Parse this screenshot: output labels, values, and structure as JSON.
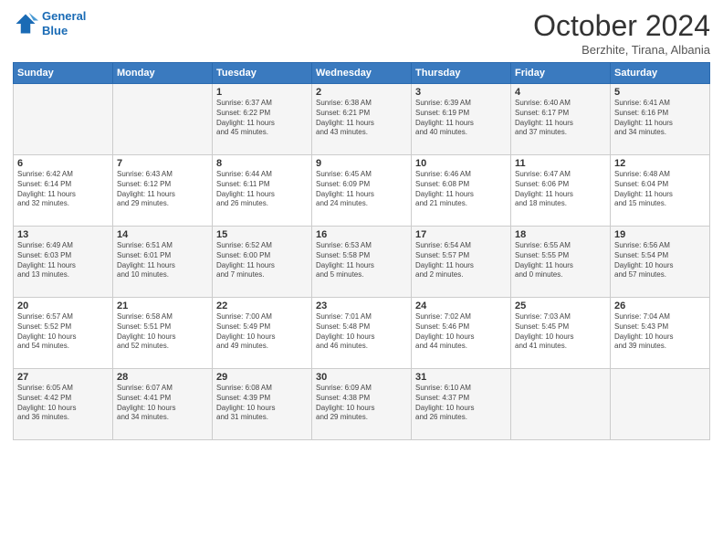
{
  "header": {
    "logo_line1": "General",
    "logo_line2": "Blue",
    "month": "October 2024",
    "location": "Berzhite, Tirana, Albania"
  },
  "weekdays": [
    "Sunday",
    "Monday",
    "Tuesday",
    "Wednesday",
    "Thursday",
    "Friday",
    "Saturday"
  ],
  "weeks": [
    [
      {
        "day": "",
        "info": ""
      },
      {
        "day": "",
        "info": ""
      },
      {
        "day": "1",
        "info": "Sunrise: 6:37 AM\nSunset: 6:22 PM\nDaylight: 11 hours\nand 45 minutes."
      },
      {
        "day": "2",
        "info": "Sunrise: 6:38 AM\nSunset: 6:21 PM\nDaylight: 11 hours\nand 43 minutes."
      },
      {
        "day": "3",
        "info": "Sunrise: 6:39 AM\nSunset: 6:19 PM\nDaylight: 11 hours\nand 40 minutes."
      },
      {
        "day": "4",
        "info": "Sunrise: 6:40 AM\nSunset: 6:17 PM\nDaylight: 11 hours\nand 37 minutes."
      },
      {
        "day": "5",
        "info": "Sunrise: 6:41 AM\nSunset: 6:16 PM\nDaylight: 11 hours\nand 34 minutes."
      }
    ],
    [
      {
        "day": "6",
        "info": "Sunrise: 6:42 AM\nSunset: 6:14 PM\nDaylight: 11 hours\nand 32 minutes."
      },
      {
        "day": "7",
        "info": "Sunrise: 6:43 AM\nSunset: 6:12 PM\nDaylight: 11 hours\nand 29 minutes."
      },
      {
        "day": "8",
        "info": "Sunrise: 6:44 AM\nSunset: 6:11 PM\nDaylight: 11 hours\nand 26 minutes."
      },
      {
        "day": "9",
        "info": "Sunrise: 6:45 AM\nSunset: 6:09 PM\nDaylight: 11 hours\nand 24 minutes."
      },
      {
        "day": "10",
        "info": "Sunrise: 6:46 AM\nSunset: 6:08 PM\nDaylight: 11 hours\nand 21 minutes."
      },
      {
        "day": "11",
        "info": "Sunrise: 6:47 AM\nSunset: 6:06 PM\nDaylight: 11 hours\nand 18 minutes."
      },
      {
        "day": "12",
        "info": "Sunrise: 6:48 AM\nSunset: 6:04 PM\nDaylight: 11 hours\nand 15 minutes."
      }
    ],
    [
      {
        "day": "13",
        "info": "Sunrise: 6:49 AM\nSunset: 6:03 PM\nDaylight: 11 hours\nand 13 minutes."
      },
      {
        "day": "14",
        "info": "Sunrise: 6:51 AM\nSunset: 6:01 PM\nDaylight: 11 hours\nand 10 minutes."
      },
      {
        "day": "15",
        "info": "Sunrise: 6:52 AM\nSunset: 6:00 PM\nDaylight: 11 hours\nand 7 minutes."
      },
      {
        "day": "16",
        "info": "Sunrise: 6:53 AM\nSunset: 5:58 PM\nDaylight: 11 hours\nand 5 minutes."
      },
      {
        "day": "17",
        "info": "Sunrise: 6:54 AM\nSunset: 5:57 PM\nDaylight: 11 hours\nand 2 minutes."
      },
      {
        "day": "18",
        "info": "Sunrise: 6:55 AM\nSunset: 5:55 PM\nDaylight: 11 hours\nand 0 minutes."
      },
      {
        "day": "19",
        "info": "Sunrise: 6:56 AM\nSunset: 5:54 PM\nDaylight: 10 hours\nand 57 minutes."
      }
    ],
    [
      {
        "day": "20",
        "info": "Sunrise: 6:57 AM\nSunset: 5:52 PM\nDaylight: 10 hours\nand 54 minutes."
      },
      {
        "day": "21",
        "info": "Sunrise: 6:58 AM\nSunset: 5:51 PM\nDaylight: 10 hours\nand 52 minutes."
      },
      {
        "day": "22",
        "info": "Sunrise: 7:00 AM\nSunset: 5:49 PM\nDaylight: 10 hours\nand 49 minutes."
      },
      {
        "day": "23",
        "info": "Sunrise: 7:01 AM\nSunset: 5:48 PM\nDaylight: 10 hours\nand 46 minutes."
      },
      {
        "day": "24",
        "info": "Sunrise: 7:02 AM\nSunset: 5:46 PM\nDaylight: 10 hours\nand 44 minutes."
      },
      {
        "day": "25",
        "info": "Sunrise: 7:03 AM\nSunset: 5:45 PM\nDaylight: 10 hours\nand 41 minutes."
      },
      {
        "day": "26",
        "info": "Sunrise: 7:04 AM\nSunset: 5:43 PM\nDaylight: 10 hours\nand 39 minutes."
      }
    ],
    [
      {
        "day": "27",
        "info": "Sunrise: 6:05 AM\nSunset: 4:42 PM\nDaylight: 10 hours\nand 36 minutes."
      },
      {
        "day": "28",
        "info": "Sunrise: 6:07 AM\nSunset: 4:41 PM\nDaylight: 10 hours\nand 34 minutes."
      },
      {
        "day": "29",
        "info": "Sunrise: 6:08 AM\nSunset: 4:39 PM\nDaylight: 10 hours\nand 31 minutes."
      },
      {
        "day": "30",
        "info": "Sunrise: 6:09 AM\nSunset: 4:38 PM\nDaylight: 10 hours\nand 29 minutes."
      },
      {
        "day": "31",
        "info": "Sunrise: 6:10 AM\nSunset: 4:37 PM\nDaylight: 10 hours\nand 26 minutes."
      },
      {
        "day": "",
        "info": ""
      },
      {
        "day": "",
        "info": ""
      }
    ]
  ]
}
